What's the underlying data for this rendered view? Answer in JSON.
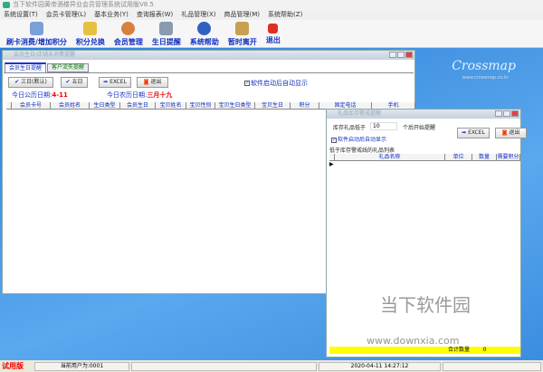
{
  "app": {
    "title": "当下软件园黄帝酒楼异业会员管理系统试用版V8.5"
  },
  "menu": [
    "系统设置(T)",
    "会员卡管理(L)",
    "基本业务(Y)",
    "查询报表(W)",
    "礼品管理(X)",
    "商品管理(M)",
    "系统帮助(Z)"
  ],
  "toolbar": [
    "刷卡消费/增加积分",
    "积分兑换",
    "会员管理",
    "生日提醒",
    "系统帮助",
    "暂时离开",
    "退出"
  ],
  "desktop": {
    "brand": "Crossmap",
    "brand_url": "www.crossmap.co.kr",
    "watermark": "当下软件园",
    "watermark_url": "www.downxia.com"
  },
  "birthday": {
    "title": "会员生日/店铺未消费提醒",
    "tabs": [
      "会员生日提醒",
      "客户流失提醒"
    ],
    "buttons": [
      "三日(默认)",
      "五日",
      "EXCEL",
      "退出"
    ],
    "auto_show": "软件启动后自动显示",
    "today_solar_label": "今日公历日期:",
    "today_solar": "4-11",
    "today_lunar_label": "今日农历日期:",
    "today_lunar": "三月十九",
    "columns": [
      "会员卡号",
      "会员姓名",
      "生日类型",
      "会员生日",
      "宝贝姓名",
      "宝贝性别",
      "宝贝生日类型",
      "宝贝生日",
      "积分",
      "固定电话",
      "手机"
    ]
  },
  "gift": {
    "title": "礼品库存警戒提醒",
    "threshold_label": "库存礼品低于",
    "threshold": "10",
    "threshold_suffix": "个后开始提醒",
    "buttons": [
      "EXCEL",
      "退出"
    ],
    "auto_show": "软件启动后自动显示",
    "list_label": "低于库存警戒线的礼品列表",
    "columns": [
      "礼品名称",
      "单位",
      "数量",
      "需要积分"
    ],
    "total_label": "合计数量",
    "total": "0"
  },
  "status": {
    "edition": "试用版",
    "user": "当前用户为:0001",
    "datetime": "2020-04-11 14:27:12"
  }
}
